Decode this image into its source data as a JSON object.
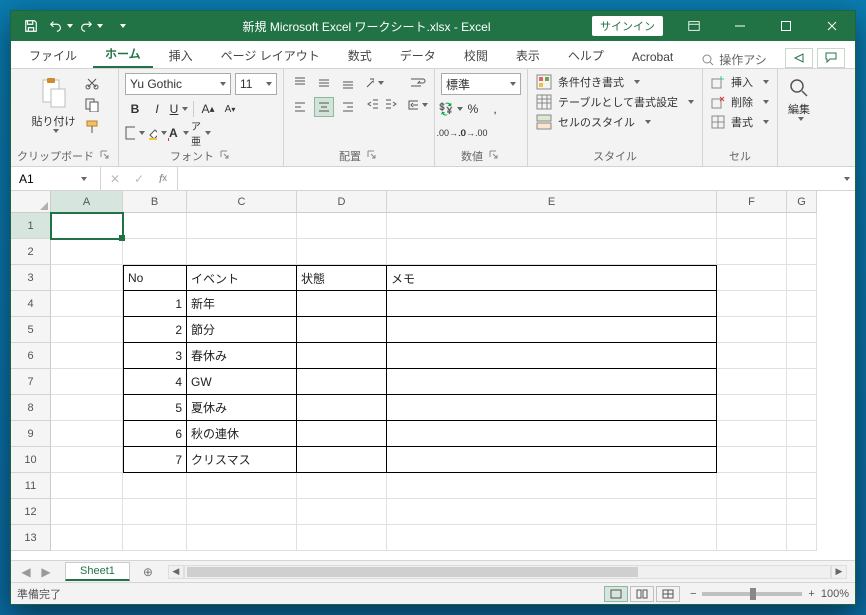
{
  "title": "新規 Microsoft Excel ワークシート.xlsx  -  Excel",
  "signin": "サインイン",
  "tabs": [
    "ファイル",
    "ホーム",
    "挿入",
    "ページ レイアウト",
    "数式",
    "データ",
    "校閲",
    "表示",
    "ヘルプ",
    "Acrobat"
  ],
  "active_tab": 1,
  "tell_me": "操作アシ",
  "ribbon": {
    "clipboard": {
      "paste": "貼り付け",
      "label": "クリップボード"
    },
    "font": {
      "name": "Yu Gothic",
      "size": "11",
      "label": "フォント",
      "bold": "B",
      "italic": "I",
      "underline": "U",
      "increase": "A",
      "decrease": "A"
    },
    "alignment": {
      "label": "配置"
    },
    "number": {
      "format": "標準",
      "label": "数値"
    },
    "styles": {
      "cond": "条件付き書式",
      "table": "テーブルとして書式設定",
      "cell": "セルのスタイル",
      "label": "スタイル"
    },
    "cells": {
      "insert": "挿入",
      "delete": "削除",
      "format": "書式",
      "label": "セル"
    },
    "editing": {
      "label": "編集"
    }
  },
  "name_box": "A1",
  "columns": [
    "A",
    "B",
    "C",
    "D",
    "E",
    "F",
    "G"
  ],
  "row_count": 13,
  "table": {
    "headers": {
      "no": "No",
      "event": "イベント",
      "state": "状態",
      "memo": "メモ"
    },
    "rows": [
      {
        "no": "1",
        "event": "新年"
      },
      {
        "no": "2",
        "event": "節分"
      },
      {
        "no": "3",
        "event": "春休み"
      },
      {
        "no": "4",
        "event": "GW"
      },
      {
        "no": "5",
        "event": "夏休み"
      },
      {
        "no": "6",
        "event": "秋の連休"
      },
      {
        "no": "7",
        "event": "クリスマス"
      }
    ]
  },
  "sheet_tab": "Sheet1",
  "status_text": "準備完了",
  "zoom": "100%"
}
